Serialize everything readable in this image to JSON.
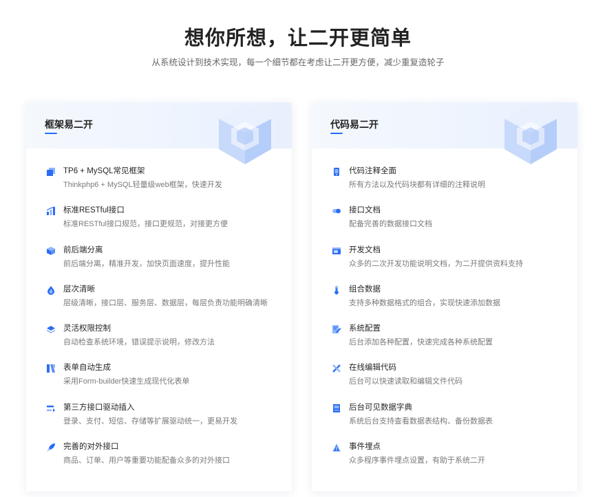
{
  "hero": {
    "title": "想你所想，让二开更简单",
    "subtitle": "从系统设计到技术实现，每一个细节都在考虑让二开更方便，减少重复造轮子"
  },
  "colors": {
    "accent": "#1f6fff",
    "icon_light": "#8fb5fb",
    "icon_dark": "#2a6df4"
  },
  "cards": [
    {
      "title": "框架易二开",
      "features": [
        {
          "icon": "blocks-icon",
          "title": "TP6 + MySQL常见框架",
          "desc": "Thinkphp6 + MySQL轻量级web框架，快速开发"
        },
        {
          "icon": "chart-icon",
          "title": "标准RESTful接口",
          "desc": "标准RESTful接口规范，接口更规范，对接更方便"
        },
        {
          "icon": "box-icon",
          "title": "前后端分离",
          "desc": "前后端分离，精准开发，加快页面速度，提升性能"
        },
        {
          "icon": "drop-icon",
          "title": "层次清晰",
          "desc": "层级清晰，接口层、服务层、数据层，每层负责功能明确清晰"
        },
        {
          "icon": "layers-icon",
          "title": "灵活权限控制",
          "desc": "自动检查系统环境，错误提示说明，修改方法"
        },
        {
          "icon": "form-icon",
          "title": "表单自动生成",
          "desc": "采用Form-builder快速生成现代化表单"
        },
        {
          "icon": "plug-icon",
          "title": "第三方接口驱动插入",
          "desc": "登录、支付、短信、存储等扩展驱动统一，更易开发"
        },
        {
          "icon": "rocket-icon",
          "title": "完善的对外接口",
          "desc": "商品、订单、用户等重要功能配备众多的对外接口"
        }
      ]
    },
    {
      "title": "代码易二开",
      "features": [
        {
          "icon": "phone-icon",
          "title": "代码注释全面",
          "desc": "所有方法以及代码块都有详细的注释说明"
        },
        {
          "icon": "toggle-icon",
          "title": "接口文档",
          "desc": "配备完善的数据接口文档"
        },
        {
          "icon": "window-icon",
          "title": "开发文档",
          "desc": "众多的二次开发功能说明文档，为二开提供资料支持"
        },
        {
          "icon": "thermometer-icon",
          "title": "组合数据",
          "desc": "支持多种数据格式的组合，实现快速添加数据"
        },
        {
          "icon": "document-edit-icon",
          "title": "系统配置",
          "desc": "后台添加各种配置，快速完成各种系统配置"
        },
        {
          "icon": "pencil-cross-icon",
          "title": "在线编辑代码",
          "desc": "后台可以快速读取和编辑文件代码"
        },
        {
          "icon": "dictionary-icon",
          "title": "后台可见数据字典",
          "desc": "系统后台支持查看数据表结构、备份数据表"
        },
        {
          "icon": "warning-icon",
          "title": "事件埋点",
          "desc": "众多程序事件埋点设置，有助于系统二开"
        }
      ]
    }
  ]
}
